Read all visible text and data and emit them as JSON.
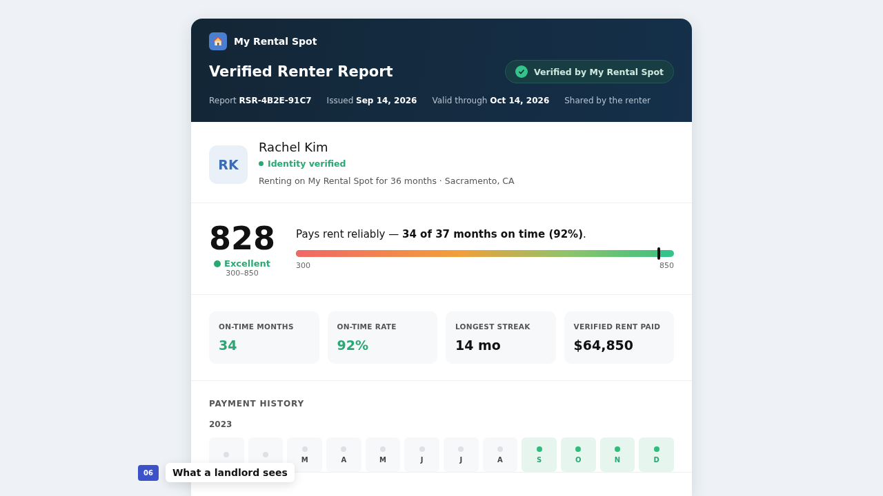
{
  "brand": {
    "name": "My Rental Spot"
  },
  "header": {
    "title": "Verified Renter Report",
    "badge": "Verified by My Rental Spot",
    "meta": [
      {
        "label": "Report",
        "value": "RSR-4B2E-91C7"
      },
      {
        "label": "Issued",
        "value": "Sep 14, 2026"
      },
      {
        "label": "Valid through",
        "value": "Oct 14, 2026"
      },
      {
        "label": "Shared by the renter"
      }
    ]
  },
  "renter": {
    "initials": "RK",
    "name": "Rachel Kim",
    "status": "Identity verified",
    "verified": true,
    "detail": "Renting on My Rental Spot for 36 months · Sacramento, CA"
  },
  "score": {
    "value": "828",
    "rating": "Excellent",
    "range": "300–850",
    "summary": "Pays rent reliably — **34 of 37 months on time (92%)**.",
    "level": 0.96,
    "min": "300",
    "max": "850"
  },
  "stats": [
    {
      "label": "ON-TIME MONTHS",
      "value": "34",
      "highlight": true
    },
    {
      "label": "ON-TIME RATE",
      "value": "92%",
      "highlight": true
    },
    {
      "label": "LONGEST STREAK",
      "value": "14 mo",
      "highlight": false
    },
    {
      "label": "VERIFIED RENT PAID",
      "value": "$64,850",
      "highlight": false
    }
  ],
  "history": {
    "title": "PAYMENT HISTORY",
    "year": "2023",
    "months": [
      {
        "paid": false
      },
      {
        "paid": false
      },
      {
        "label": "M",
        "paid": false
      },
      {
        "label": "A",
        "paid": false
      },
      {
        "label": "M",
        "paid": false
      },
      {
        "label": "J",
        "paid": false
      },
      {
        "label": "J",
        "paid": false
      },
      {
        "label": "A",
        "paid": false
      },
      {
        "label": "S",
        "paid": true
      },
      {
        "label": "O",
        "paid": true
      },
      {
        "label": "N",
        "paid": true
      },
      {
        "label": "D",
        "paid": true
      }
    ]
  },
  "caption": {
    "step": "06",
    "text": "What a landlord sees"
  }
}
